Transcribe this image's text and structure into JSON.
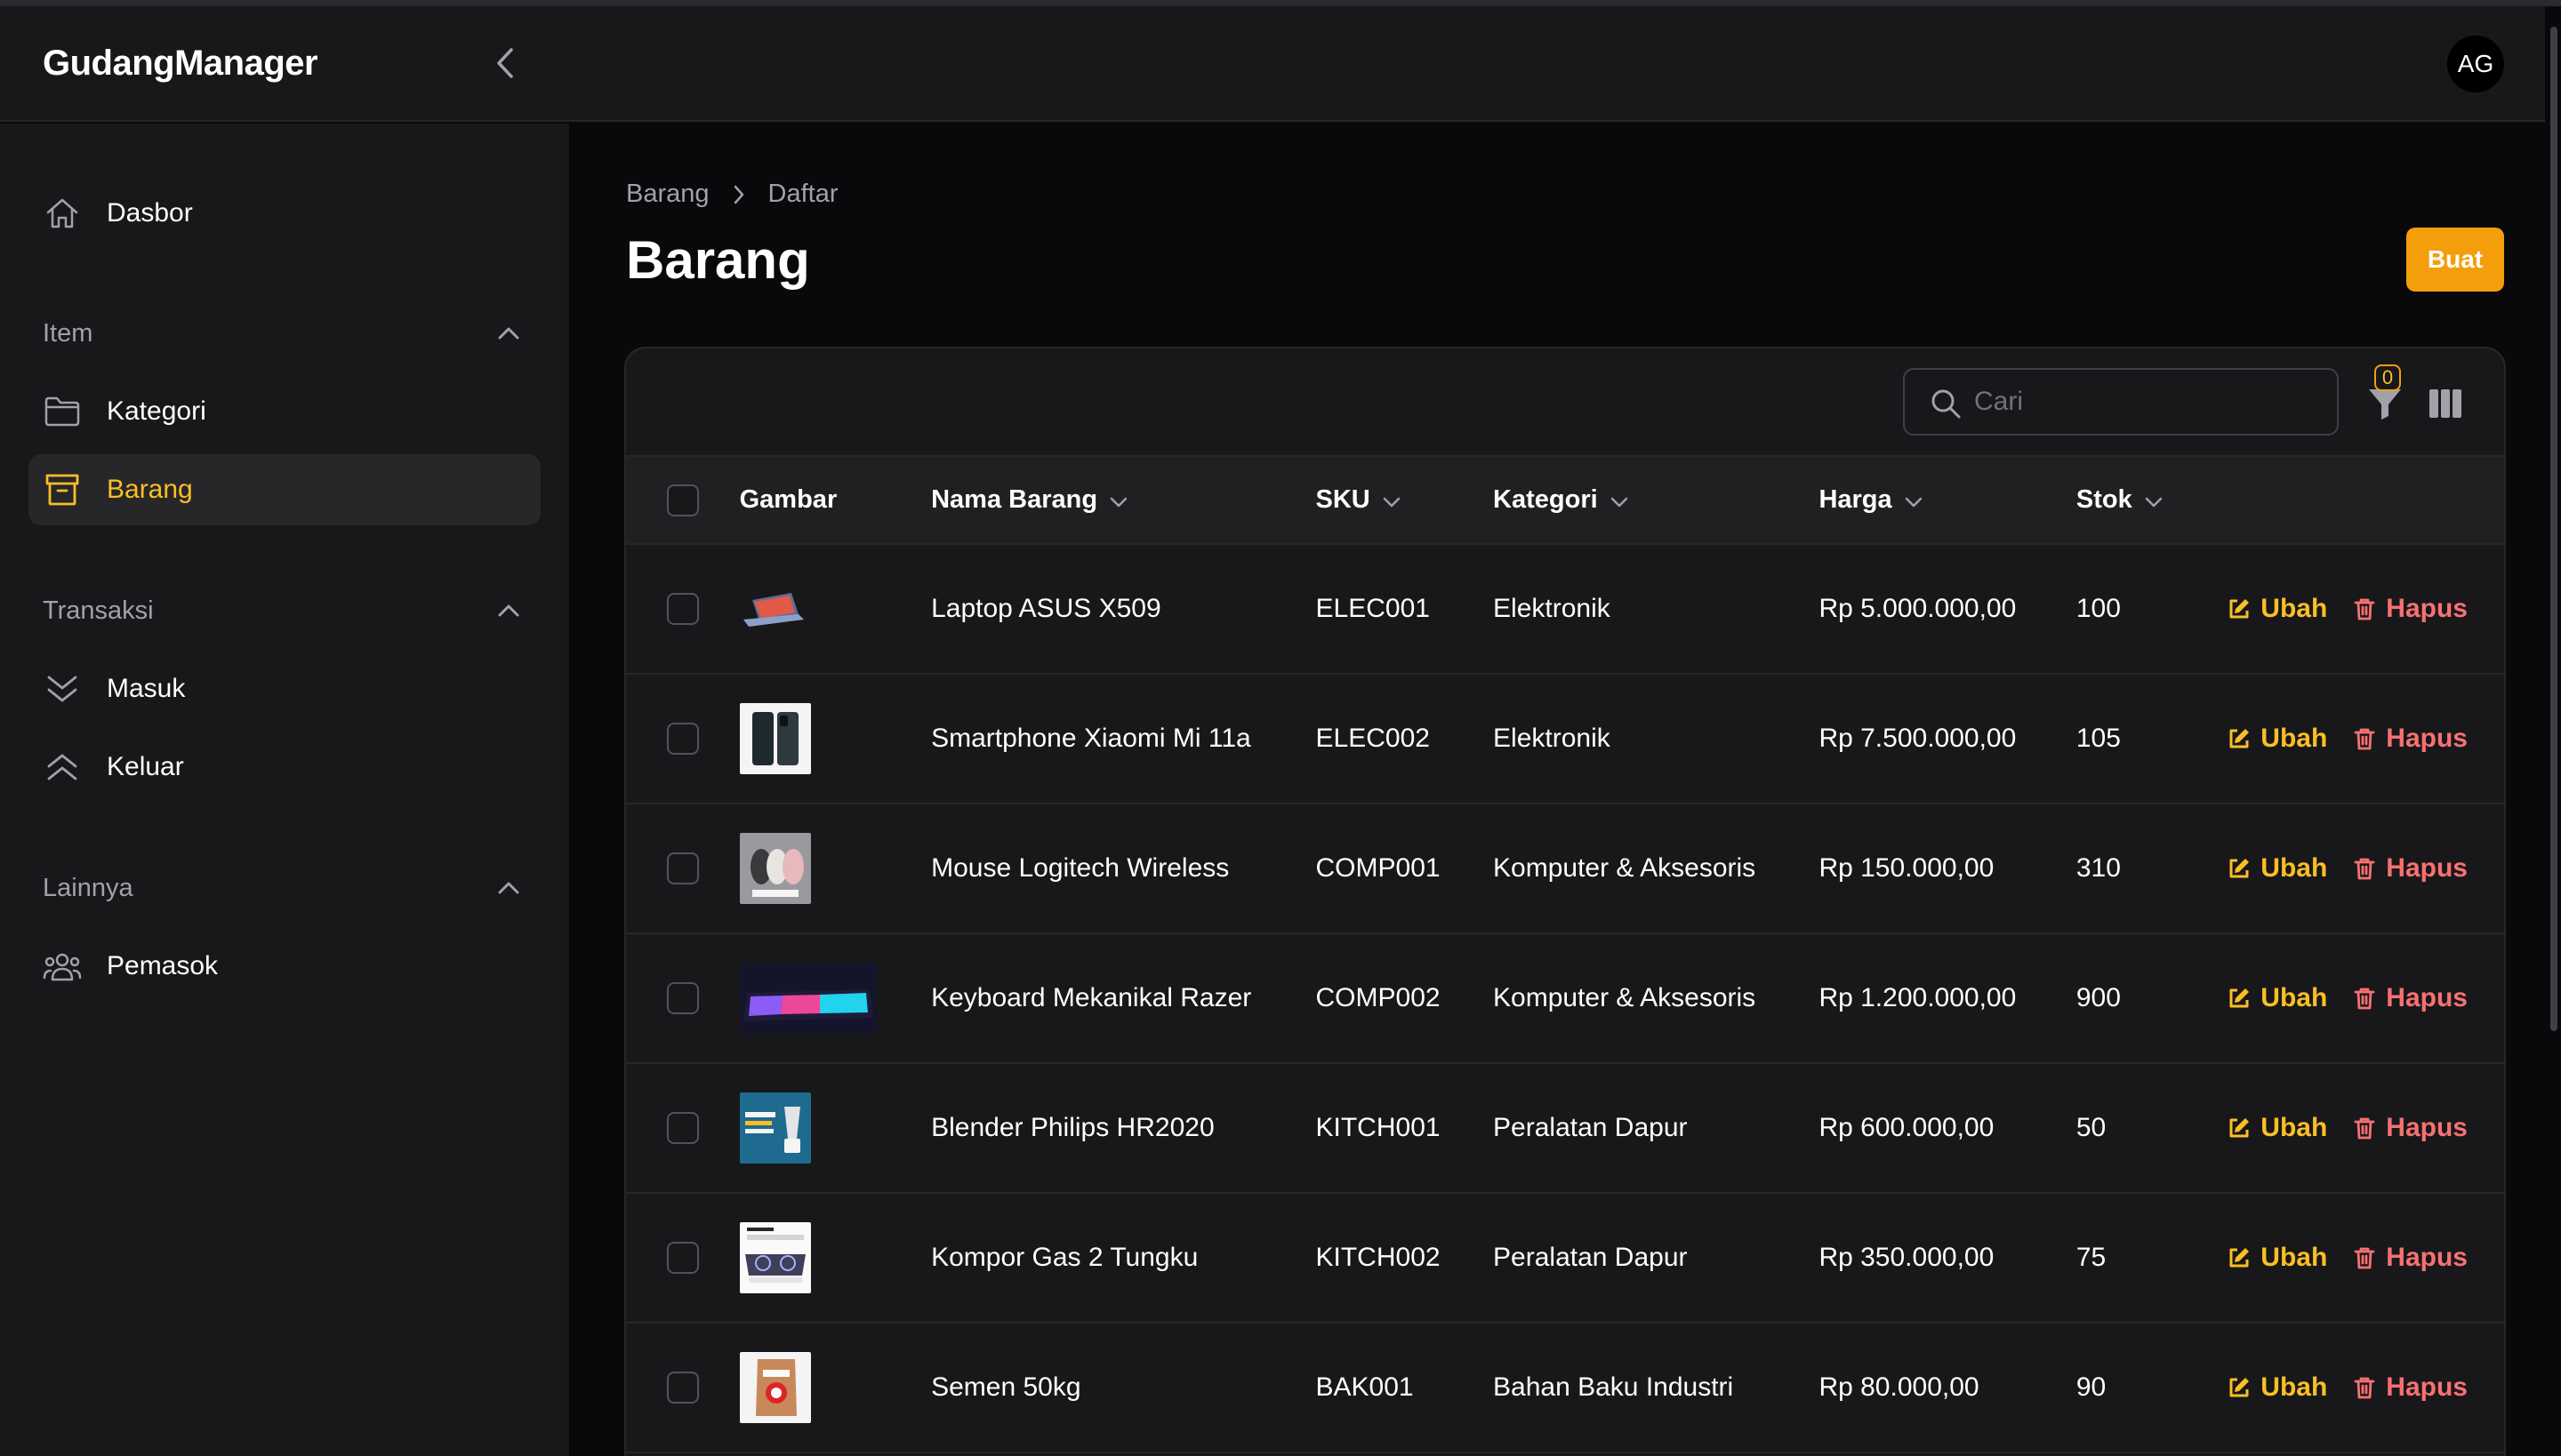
{
  "app": {
    "brand": "GudangManager",
    "avatar_initials": "AG"
  },
  "sidebar": {
    "dashboard": "Dasbor",
    "groups": [
      {
        "label": "Item",
        "items": [
          "Kategori",
          "Barang"
        ]
      },
      {
        "label": "Transaksi",
        "items": [
          "Masuk",
          "Keluar"
        ]
      },
      {
        "label": "Lainnya",
        "items": [
          "Pemasok"
        ]
      }
    ],
    "active_item": "Barang"
  },
  "breadcrumb": [
    "Barang",
    "Daftar"
  ],
  "page": {
    "title": "Barang",
    "create_label": "Buat"
  },
  "toolbar": {
    "search_placeholder": "Cari",
    "filter_count": "0"
  },
  "table": {
    "columns": [
      "Gambar",
      "Nama Barang",
      "SKU",
      "Kategori",
      "Harga",
      "Stok"
    ],
    "rows": [
      {
        "image": "laptop-image",
        "name": "Laptop ASUS X509",
        "sku": "ELEC001",
        "category": "Elektronik",
        "price": "Rp 5.000.000,00",
        "stock": "100"
      },
      {
        "image": "smartphone-image",
        "name": "Smartphone Xiaomi Mi 11a",
        "sku": "ELEC002",
        "category": "Elektronik",
        "price": "Rp 7.500.000,00",
        "stock": "105"
      },
      {
        "image": "mouse-image",
        "name": "Mouse Logitech Wireless",
        "sku": "COMP001",
        "category": "Komputer & Aksesoris",
        "price": "Rp 150.000,00",
        "stock": "310"
      },
      {
        "image": "keyboard-image",
        "name": "Keyboard Mekanikal Razer",
        "sku": "COMP002",
        "category": "Komputer & Aksesoris",
        "price": "Rp 1.200.000,00",
        "stock": "900"
      },
      {
        "image": "blender-image",
        "name": "Blender Philips HR2020",
        "sku": "KITCH001",
        "category": "Peralatan Dapur",
        "price": "Rp 600.000,00",
        "stock": "50"
      },
      {
        "image": "stove-image",
        "name": "Kompor Gas 2 Tungku",
        "sku": "KITCH002",
        "category": "Peralatan Dapur",
        "price": "Rp 350.000,00",
        "stock": "75"
      },
      {
        "image": "cement-image",
        "name": "Semen 50kg",
        "sku": "BAK001",
        "category": "Bahan Baku Industri",
        "price": "Rp 80.000,00",
        "stock": "90"
      }
    ],
    "edit_label": "Ubah",
    "delete_label": "Hapus"
  },
  "colors": {
    "accent": "#f59e0b",
    "danger": "#f87171",
    "background": "#09090b",
    "panel": "#18181b"
  }
}
